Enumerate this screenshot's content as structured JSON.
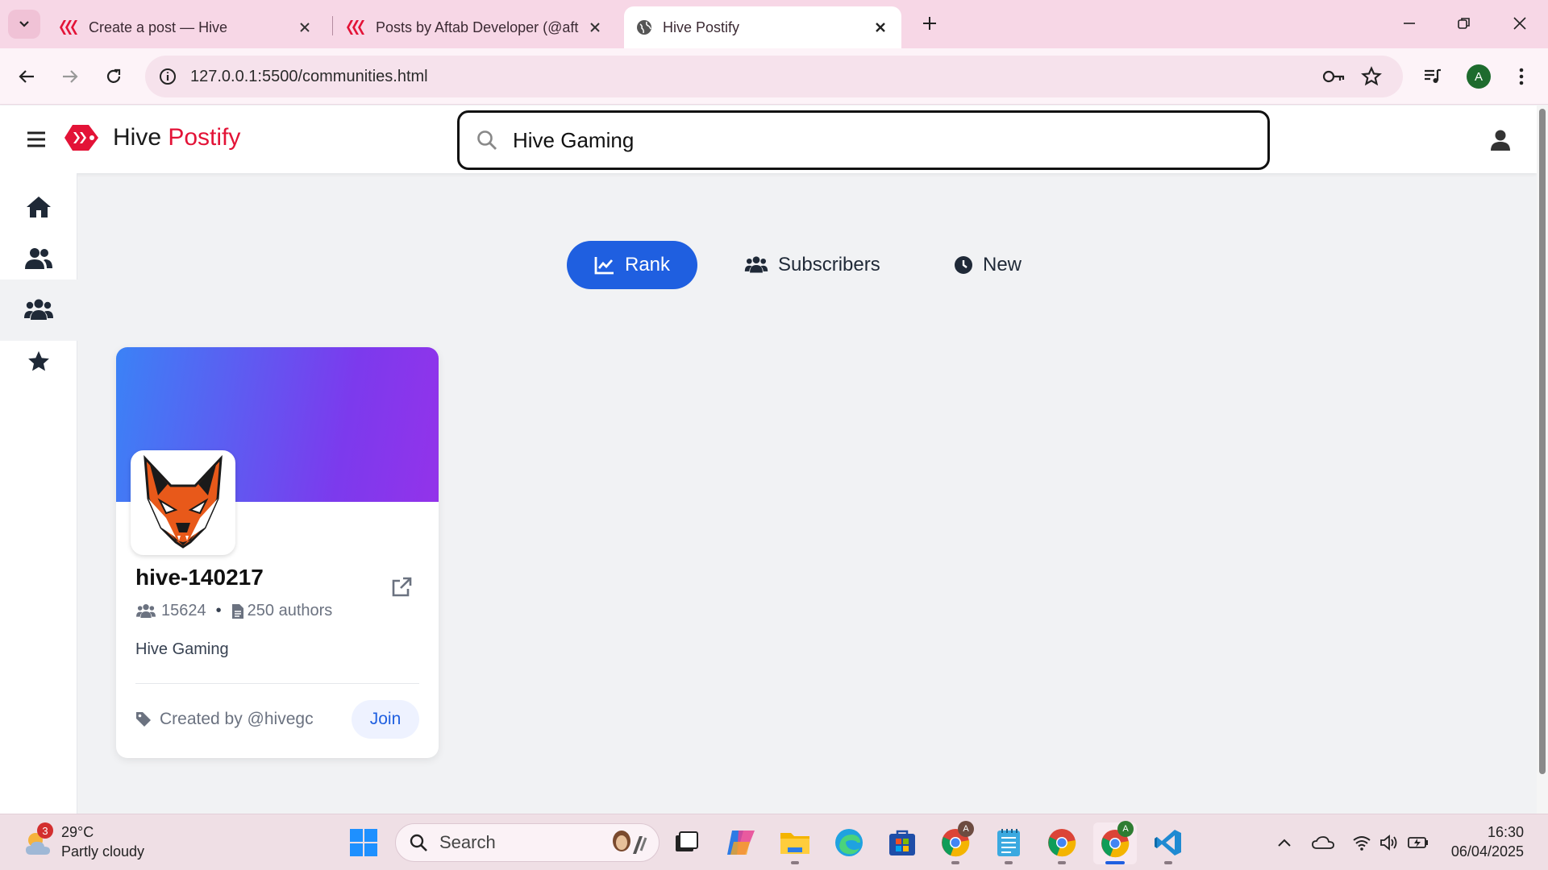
{
  "browser": {
    "tabs": [
      {
        "title": "Create a post — Hive",
        "active": false
      },
      {
        "title": "Posts by Aftab Developer (@aft",
        "active": false
      },
      {
        "title": "Hive Postify",
        "active": true
      }
    ],
    "url": "127.0.0.1:5500/communities.html",
    "profile_initial": "A"
  },
  "app": {
    "logo_main": "Hive",
    "logo_accent": "Postify",
    "accent_color": "#e31337",
    "search_value": "Hive Gaming",
    "sort_tabs": [
      {
        "label": "Rank",
        "icon": "chart-line-icon",
        "active": true
      },
      {
        "label": "Subscribers",
        "icon": "users-icon",
        "active": false
      },
      {
        "label": "New",
        "icon": "clock-icon",
        "active": false
      }
    ],
    "sidebar": [
      {
        "name": "home",
        "icon": "home-icon",
        "active": false
      },
      {
        "name": "people",
        "icon": "user-group-icon",
        "active": false
      },
      {
        "name": "communities",
        "icon": "users-icon",
        "active": true
      },
      {
        "name": "favorites",
        "icon": "star-icon",
        "active": false
      }
    ],
    "community": {
      "name": "hive-140217",
      "subscribers": "15624",
      "authors": "250 authors",
      "description": "Hive Gaming",
      "creator": "Created by @hivegc",
      "join_label": "Join"
    }
  },
  "taskbar": {
    "weather_temp": "29°C",
    "weather_desc": "Partly cloudy",
    "weather_badge": "3",
    "search_label": "Search",
    "time": "16:30",
    "date": "06/04/2025"
  }
}
